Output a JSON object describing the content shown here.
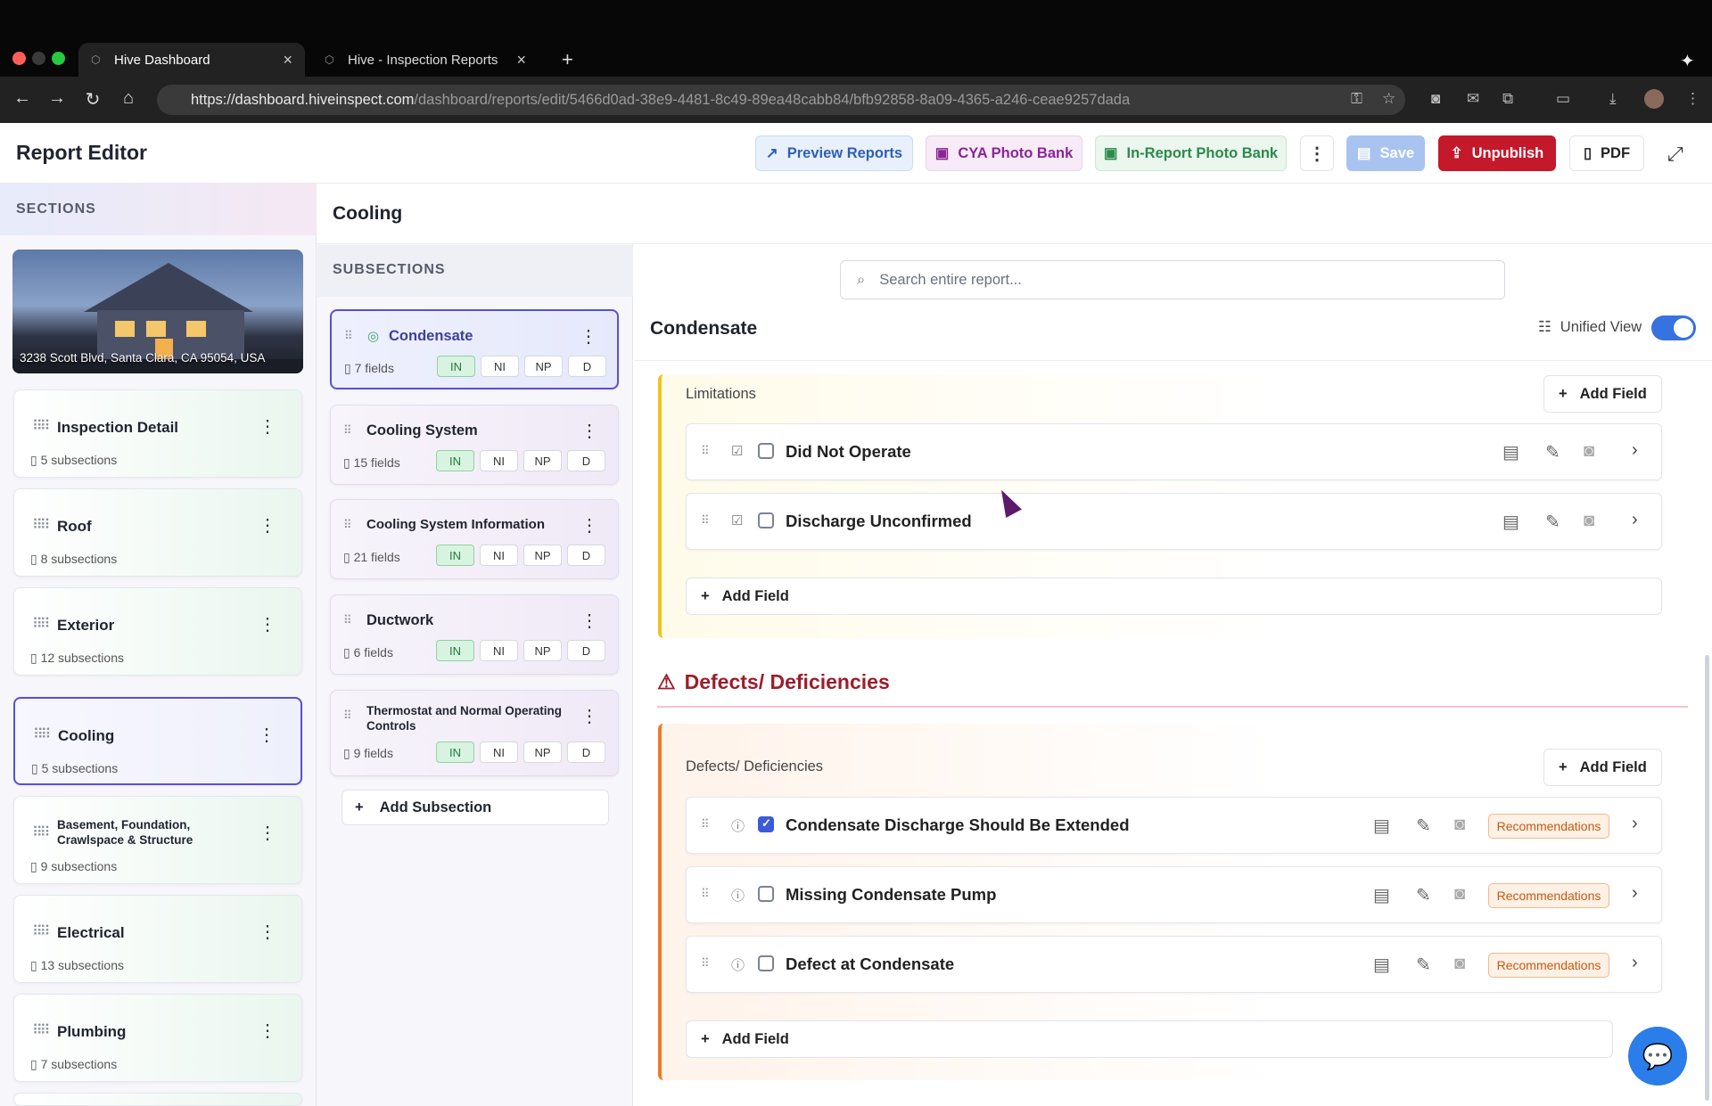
{
  "browser": {
    "tabs": [
      {
        "title": "Hive Dashboard",
        "active": true
      },
      {
        "title": "Hive - Inspection Reports",
        "active": false
      }
    ],
    "new_tab": "+",
    "close_glyph": "×",
    "url_host": "https://dashboard.hiveinspect.com",
    "url_path": "/dashboard/reports/edit/5466d0ad-38e9-4481-8c49-89ea48cabb84/bfb92858-8a09-4365-a246-ceae9257dada"
  },
  "header": {
    "title": "Report Editor",
    "buttons": {
      "preview": "Preview Reports",
      "cya": "CYA Photo Bank",
      "in_report": "In-Report Photo Bank",
      "save": "Save",
      "unpublish": "Unpublish",
      "pdf": "PDF"
    }
  },
  "sections": {
    "label": "SECTIONS",
    "address": "3238 Scott Blvd, Santa Clara, CA 95054, USA",
    "items": [
      {
        "name": "Inspection Detail",
        "sub": "5 subsections"
      },
      {
        "name": "Roof",
        "sub": "8 subsections"
      },
      {
        "name": "Exterior",
        "sub": "12 subsections"
      },
      {
        "name": "Cooling",
        "sub": "5 subsections",
        "active": true
      },
      {
        "name": "Basement, Foundation, Crawlspace & Structure",
        "sub": "9 subsections"
      },
      {
        "name": "Electrical",
        "sub": "13 subsections"
      },
      {
        "name": "Plumbing",
        "sub": "7 subsections"
      }
    ]
  },
  "section_title": "Cooling",
  "subsections": {
    "label": "SUBSECTIONS",
    "pill_labels": [
      "IN",
      "NI",
      "NP",
      "D"
    ],
    "items": [
      {
        "name": "Condensate",
        "fields": "7 fields",
        "active": true
      },
      {
        "name": "Cooling System",
        "fields": "15 fields"
      },
      {
        "name": "Cooling System Information",
        "fields": "21 fields"
      },
      {
        "name": "Ductwork",
        "fields": "6 fields"
      },
      {
        "name": "Thermostat and Normal Operating Controls",
        "fields": "9 fields"
      }
    ],
    "add_label": "Add Subsection"
  },
  "content": {
    "search_placeholder": "Search entire report...",
    "title": "Condensate",
    "unified_view_label": "Unified View",
    "unified_view_on": true,
    "add_field_label": "Add Field",
    "limitations": {
      "label": "Limitations",
      "fields": [
        {
          "name": "Did Not Operate",
          "checked": false
        },
        {
          "name": "Discharge Unconfirmed",
          "checked": false
        }
      ]
    },
    "defects": {
      "heading": "Defects/ Deficiencies",
      "label": "Defects/ Deficiencies",
      "tag": "Recommendations",
      "fields": [
        {
          "name": "Condensate Discharge Should Be Extended",
          "checked": true
        },
        {
          "name": "Missing Condensate Pump",
          "checked": false
        },
        {
          "name": "Defect at Condensate",
          "checked": false
        }
      ]
    }
  },
  "colors": {
    "accent": "#5a4fd1",
    "unpublish": "#c4182b",
    "limitations_bar": "#f0c419",
    "defects_bar": "#f07a24",
    "chat": "#2b7de9"
  }
}
